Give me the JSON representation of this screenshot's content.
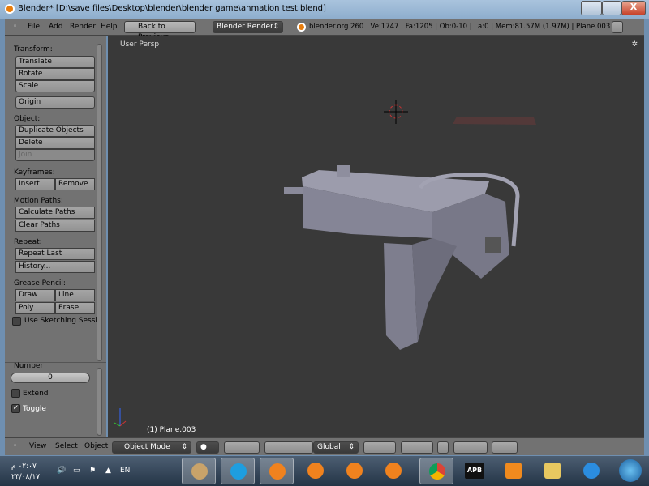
{
  "window": {
    "title": "Blender* [D:\\save files\\Desktop\\blender\\blender game\\anmation test.blend]",
    "close_label": "X"
  },
  "header": {
    "menus": [
      "File",
      "Add",
      "Render",
      "Help"
    ],
    "back_button": "Back to Previous",
    "render_engine": "Blender Render",
    "stats": "blender.org 260 | Ve:1747 | Fa:1205 | Ob:0-10 | La:0 | Mem:81.57M (1.97M) | Plane.003"
  },
  "toolshelf": {
    "transform_label": "Transform:",
    "translate": "Translate",
    "rotate": "Rotate",
    "scale": "Scale",
    "origin": "Origin",
    "object_label": "Object:",
    "duplicate": "Duplicate Objects",
    "delete": "Delete",
    "join": "Join",
    "keyframes_label": "Keyframes:",
    "insert": "Insert",
    "remove": "Remove",
    "motion_label": "Motion Paths:",
    "calc_paths": "Calculate Paths",
    "clear_paths": "Clear Paths",
    "repeat_label": "Repeat:",
    "repeat_last": "Repeat Last",
    "history": "History...",
    "grease_label": "Grease Pencil:",
    "draw": "Draw",
    "line": "Line",
    "poly": "Poly",
    "erase": "Erase",
    "sketching": "Use Sketching Sessio",
    "sketching_checked": false
  },
  "operator": {
    "number_label": "Number",
    "number_value": "0",
    "extend": "Extend",
    "extend_checked": false,
    "toggle": "Toggle",
    "toggle_checked": true
  },
  "viewport": {
    "view_name": "User Persp",
    "object_label": "(1) Plane.003"
  },
  "bottom": {
    "menus": [
      "View",
      "Select",
      "Object"
    ],
    "mode": "Object Mode",
    "orientation": "Global"
  },
  "taskbar": {
    "time": "٠٢:٠٧ م",
    "date": "٢٣/٠٨/١٧",
    "lang": "EN",
    "apb": "APB"
  }
}
